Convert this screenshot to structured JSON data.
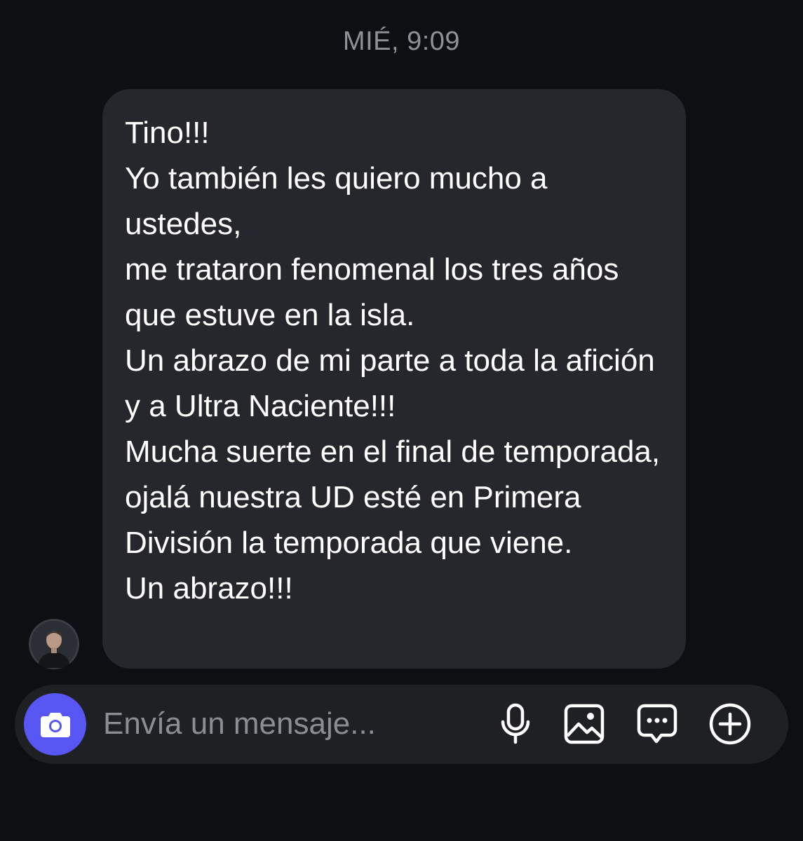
{
  "conversation": {
    "timestamp": "MIÉ, 9:09"
  },
  "message": {
    "sender_avatar": "sender-avatar",
    "text": "Tino!!!\nYo también les quiero mucho a ustedes,\nme trataron fenomenal los tres años que estuve en la isla.\nUn abrazo de mi parte a toda la afición y a Ultra Naciente!!!\nMucha suerte en el final de temporada, ojalá nuestra UD esté en Primera División la temporada que viene.\nUn abrazo!!!"
  },
  "composer": {
    "placeholder": "Envía un mensaje...",
    "value": "",
    "icons": [
      "camera-icon",
      "microphone-icon",
      "image-icon",
      "chat-bubble-icon",
      "plus-circle-icon"
    ]
  },
  "colors": {
    "background": "#0d0f13",
    "bubble": "#25272c",
    "composer": "#1e2024",
    "camera_accent": "#5856f2",
    "timestamp": "#8e9197"
  }
}
